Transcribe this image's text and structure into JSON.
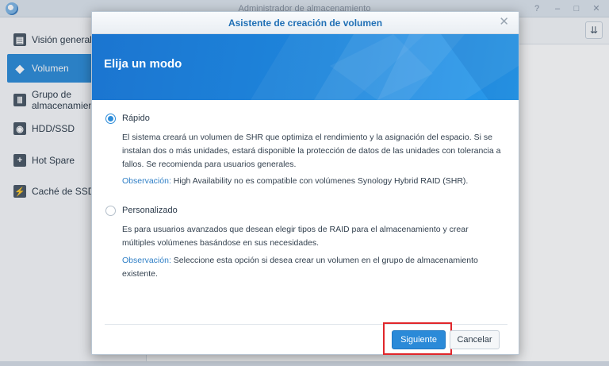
{
  "app": {
    "title": "Administrador de almacenamiento",
    "controls": {
      "help": "?",
      "minimize": "–",
      "maximize": "□",
      "close": "✕"
    },
    "sort_icon": "sort-icon"
  },
  "sidebar": {
    "items": [
      {
        "label": "Visión general",
        "icon": "overview-icon",
        "glyph": "▤",
        "active": false
      },
      {
        "label": "Volumen",
        "icon": "volume-icon",
        "glyph": "◆",
        "active": true
      },
      {
        "label": "Grupo de almacenamiento",
        "icon": "storage-pool-icon",
        "glyph": "Ⅲ",
        "active": false
      },
      {
        "label": "HDD/SSD",
        "icon": "drive-icon",
        "glyph": "◉",
        "active": false
      },
      {
        "label": "Hot Spare",
        "icon": "hot-spare-icon",
        "glyph": "+",
        "active": false
      },
      {
        "label": "Caché de SSD",
        "icon": "ssd-cache-icon",
        "glyph": "⚡",
        "active": false
      }
    ]
  },
  "dialog": {
    "title": "Asistente de creación de volumen",
    "close_glyph": "✕",
    "heading": "Elija un modo",
    "options": [
      {
        "label": "Rápido",
        "checked": true,
        "description": "El sistema creará un volumen de SHR que optimiza el rendimiento y la asignación del espacio. Si se instalan dos o más unidades, estará disponible la protección de datos de las unidades con tolerancia a fallos. Se recomienda para usuarios generales.",
        "note_key": "Observación:",
        "note_text": " High Availability no es compatible con volúmenes Synology Hybrid RAID (SHR)."
      },
      {
        "label": "Personalizado",
        "checked": false,
        "description": "Es para usuarios avanzados que desean elegir tipos de RAID para el almacenamiento y crear múltiples volúmenes basándose en sus necesidades.",
        "note_key": "Observación:",
        "note_text": " Seleccione esta opción si desea crear un volumen en el grupo de almacenamiento existente."
      }
    ],
    "buttons": {
      "next": "Siguiente",
      "cancel": "Cancelar"
    }
  },
  "colors": {
    "accent": "#2d8cd9",
    "banner": "#1e86dc",
    "highlight": "#e0262b"
  }
}
